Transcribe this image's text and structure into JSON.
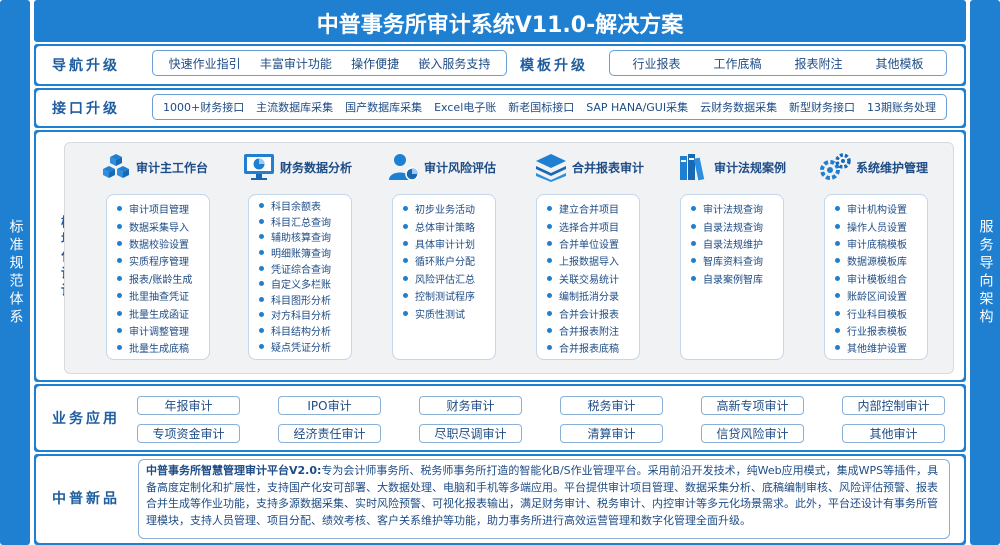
{
  "title": "中普事务所审计系统V11.0-解决方案",
  "left_side": "标准规范体系",
  "right_side": "服务导向架构",
  "nav": {
    "label": "导航升级",
    "items": [
      "快速作业指引",
      "丰富审计功能",
      "操作便捷",
      "嵌入服务支持"
    ]
  },
  "template": {
    "label": "模板升级",
    "items": [
      "行业报表",
      "工作底稿",
      "报表附注",
      "其他模板"
    ]
  },
  "interface": {
    "label": "接口升级",
    "items": [
      "1000+财务接口",
      "主流数据库采集",
      "国产数据库采集",
      "Excel电子账",
      "新老国标接口",
      "SAP HANA/GUI采集",
      "云财务数据采集",
      "新型财务接口",
      "13期账务处理"
    ]
  },
  "modular": {
    "label": "模块化设计",
    "modules": [
      {
        "title": "审计主工作台",
        "icon": "cubes-icon",
        "items": [
          "审计项目管理",
          "数据采集导入",
          "数据校验设置",
          "实质程序管理",
          "报表/账龄生成",
          "批里抽查凭证",
          "批量生成函证",
          "审计调整管理",
          "批量生成底稿"
        ]
      },
      {
        "title": "财务数据分析",
        "icon": "monitor-chart-icon",
        "items": [
          "科目余额表",
          "科目汇总查询",
          "辅助核算查询",
          "明细账簿查询",
          "凭证综合查询",
          "自定义多栏账",
          "科目图形分析",
          "对方科目分析",
          "科目结构分析",
          "疑点凭证分析"
        ]
      },
      {
        "title": "审计风险评估",
        "icon": "person-chart-icon",
        "items": [
          "初步业务活动",
          "总体审计策略",
          "具体审计计划",
          "循环账户分配",
          "风险评估汇总",
          "控制测试程序",
          "实质性测试"
        ]
      },
      {
        "title": "合并报表审计",
        "icon": "layers-icon",
        "items": [
          "建立合并项目",
          "选择合并项目",
          "合并单位设置",
          "上报数据导入",
          "关联交易统计",
          "编制抵消分录",
          "合并会计报表",
          "合并报表附注",
          "合并报表底稿"
        ]
      },
      {
        "title": "审计法规案例",
        "icon": "books-icon",
        "items": [
          "审计法规查询",
          "自录法规查询",
          "自录法规维护",
          "智库资料查询",
          "自录案例智库"
        ]
      },
      {
        "title": "系统维护管理",
        "icon": "gears-icon",
        "items": [
          "审计机构设置",
          "操作人员设置",
          "审计底稿模板",
          "数据源模板库",
          "审计模板组合",
          "账龄区间设置",
          "行业科目模板",
          "行业报表模板",
          "其他维护设置"
        ]
      }
    ]
  },
  "business": {
    "label": "业务应用",
    "row1": [
      "年报审计",
      "IPO审计",
      "财务审计",
      "税务审计",
      "高新专项审计",
      "内部控制审计"
    ],
    "row2": [
      "专项资金审计",
      "经济责任审计",
      "尽职尽调审计",
      "清算审计",
      "信贷风险审计",
      "其他审计"
    ]
  },
  "innovation": {
    "label": "中普新品",
    "heading": "中普事务所智慧管理审计平台V2.0:",
    "text": "专为会计师事务所、税务师事务所打造的智能化B/S作业管理平台。采用前沿开发技术，纯Web应用模式，集成WPS等插件，具备高度定制化和扩展性，支持国产化安可部署、大数据处理、电脑和手机等多端应用。平台提供审计项目管理、数据采集分析、底稿编制审核、风险评估预警、报表合并生成等作业功能，支持多源数据采集、实时风险预警、可视化报表输出，满足财务审计、税务审计、内控审计等多元化场景需求。此外，平台还设计有事务所管理模块，支持人员管理、项目分配、绩效考核、客户关系维护等功能，助力事务所进行高效运营管理和数字化管理全面升级。"
  }
}
